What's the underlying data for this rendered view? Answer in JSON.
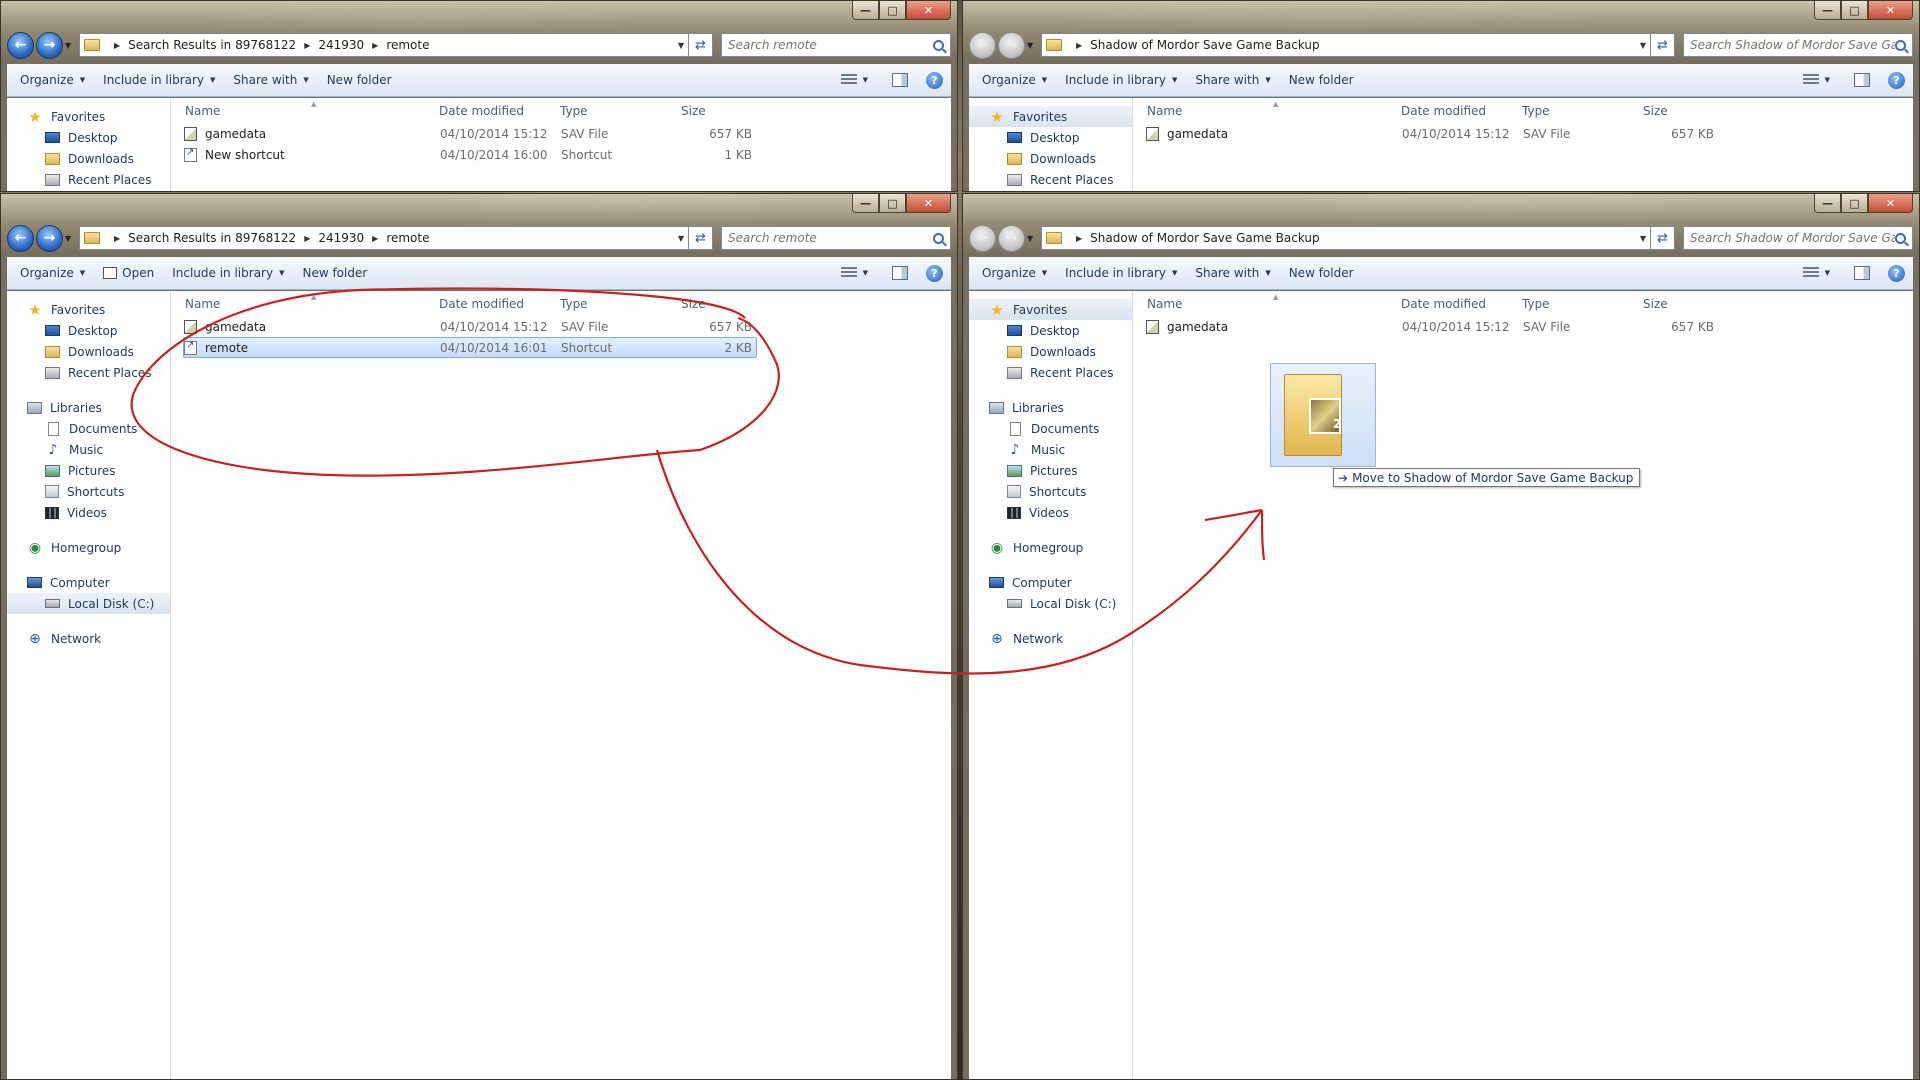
{
  "windows": {
    "top_left": {
      "address": {
        "crumbs": [
          "Search Results in 89768122",
          "241930",
          "remote"
        ]
      },
      "search_placeholder": "Search remote",
      "toolbar": [
        "Organize",
        "Include in library",
        "Share with",
        "New folder"
      ],
      "nav": {
        "favorites": {
          "label": "Favorites",
          "items": [
            "Desktop",
            "Downloads",
            "Recent Places"
          ]
        }
      },
      "columns": {
        "name": "Name",
        "date": "Date modified",
        "type": "Type",
        "size": "Size"
      },
      "files": [
        {
          "name": "gamedata",
          "date": "04/10/2014 15:12",
          "type": "SAV File",
          "size": "657 KB",
          "icon": "sav-file-icon"
        },
        {
          "name": "New shortcut",
          "date": "04/10/2014 16:00",
          "type": "Shortcut",
          "size": "1 KB",
          "icon": "shortcut-icon"
        }
      ]
    },
    "top_right": {
      "address": {
        "crumbs": [
          "Shadow of Mordor Save Game Backup"
        ]
      },
      "search_placeholder": "Search Shadow of Mordor Save Gam...",
      "toolbar": [
        "Organize",
        "Include in library",
        "Share with",
        "New folder"
      ],
      "nav": {
        "favorites": {
          "label": "Favorites",
          "items": [
            "Desktop",
            "Downloads",
            "Recent Places"
          ]
        }
      },
      "columns": {
        "name": "Name",
        "date": "Date modified",
        "type": "Type",
        "size": "Size"
      },
      "files": [
        {
          "name": "gamedata",
          "date": "04/10/2014 15:12",
          "type": "SAV File",
          "size": "657 KB",
          "icon": "sav-file-icon"
        }
      ]
    },
    "bottom_left": {
      "address": {
        "crumbs": [
          "Search Results in 89768122",
          "241930",
          "remote"
        ]
      },
      "search_placeholder": "Search remote",
      "toolbar": [
        "Organize",
        "Open",
        "Include in library",
        "New folder"
      ],
      "nav": {
        "favorites": {
          "label": "Favorites",
          "items": [
            "Desktop",
            "Downloads",
            "Recent Places"
          ]
        },
        "libraries": {
          "label": "Libraries",
          "items": [
            "Documents",
            "Music",
            "Pictures",
            "Shortcuts",
            "Videos"
          ]
        },
        "homegroup": {
          "label": "Homegroup"
        },
        "computer": {
          "label": "Computer",
          "items": [
            "Local Disk (C:)"
          ]
        },
        "network": {
          "label": "Network"
        }
      },
      "columns": {
        "name": "Name",
        "date": "Date modified",
        "type": "Type",
        "size": "Size"
      },
      "files": [
        {
          "name": "gamedata",
          "date": "04/10/2014 15:12",
          "type": "SAV File",
          "size": "657 KB",
          "icon": "sav-file-icon"
        },
        {
          "name": "remote",
          "date": "04/10/2014 16:01",
          "type": "Shortcut",
          "size": "2 KB",
          "icon": "shortcut-icon",
          "selected": true
        }
      ]
    },
    "bottom_right": {
      "address": {
        "crumbs": [
          "Shadow of Mordor Save Game Backup"
        ]
      },
      "search_placeholder": "Search Shadow of Mordor Save Gam...",
      "toolbar": [
        "Organize",
        "Include in library",
        "Share with",
        "New folder"
      ],
      "nav": {
        "favorites": {
          "label": "Favorites",
          "items": [
            "Desktop",
            "Downloads",
            "Recent Places"
          ]
        },
        "libraries": {
          "label": "Libraries",
          "items": [
            "Documents",
            "Music",
            "Pictures",
            "Shortcuts",
            "Videos"
          ]
        },
        "homegroup": {
          "label": "Homegroup"
        },
        "computer": {
          "label": "Computer",
          "items": [
            "Local Disk (C:)"
          ]
        },
        "network": {
          "label": "Network"
        }
      },
      "columns": {
        "name": "Name",
        "date": "Date modified",
        "type": "Type",
        "size": "Size"
      },
      "files": [
        {
          "name": "gamedata",
          "date": "04/10/2014 15:12",
          "type": "SAV File",
          "size": "657 KB",
          "icon": "sav-file-icon"
        }
      ]
    }
  },
  "drag": {
    "tooltip": "Move to Shadow of Mordor Save Game Backup",
    "count": "2"
  },
  "caption_buttons": {
    "minimize": "—",
    "maximize": "□",
    "close": "✕"
  },
  "colors": {
    "annotation": "#cc1f1f",
    "selection": "#c4ddfc",
    "toolbar": "#dce7f5",
    "text": "#1e395b"
  }
}
